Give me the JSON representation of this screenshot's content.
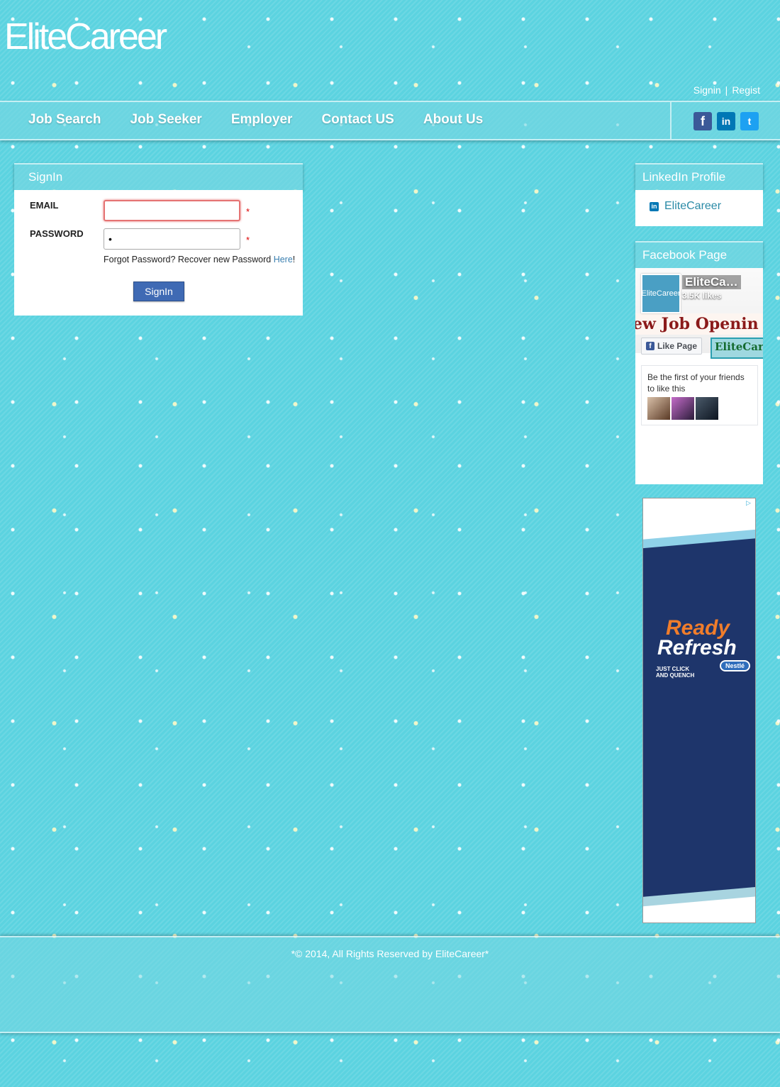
{
  "header": {
    "logo": "EliteCareer",
    "signin_link": "Signin",
    "separator": "|",
    "register_link": "Regist"
  },
  "nav": {
    "items": [
      "Job Search",
      "Job Seeker",
      "Employer",
      "Contact US",
      "About Us"
    ],
    "social": [
      {
        "icon": "facebook-icon",
        "glyph": "f"
      },
      {
        "icon": "linkedin-icon",
        "glyph": "in"
      },
      {
        "icon": "twitter-icon",
        "glyph": "t"
      }
    ]
  },
  "signin": {
    "title": "SignIn",
    "email_label": "EMAIL",
    "email_value": "",
    "password_label": "PASSWORD",
    "password_value": "•",
    "required_mark": "*",
    "forgot_text": "Forgot Password? Recover new Password ",
    "forgot_link": "Here",
    "forgot_suffix": "!",
    "button_label": "SignIn"
  },
  "linkedin_panel": {
    "title": "LinkedIn Profile",
    "link_text": "EliteCareer",
    "icon_glyph": "in"
  },
  "facebook_panel": {
    "title": "Facebook Page",
    "page_name": "EliteCa…",
    "avatar_text": "EliteCareer",
    "likes": "3.5K likes",
    "banner_text": "ew Job Openin",
    "like_button": "Like Page",
    "like_glyph": "f",
    "cover_brand": "EliteCar",
    "friends_text": "Be the first of your friends to like this"
  },
  "ad": {
    "ready": "Ready",
    "refresh": "Refresh",
    "tagline_1": "JUST CLICK",
    "tagline_2": "AND QUENCH",
    "brand": "Nestlé",
    "choice_glyph": "▷"
  },
  "footer": {
    "copyright": "*© 2014, All Rights Reserved by EliteCareer*"
  },
  "colors": {
    "background": "#5bd3e0",
    "facebook": "#3b5998",
    "linkedin": "#0077b5",
    "twitter": "#1da1f2",
    "signin_button": "#3f6ab4",
    "link": "#3a7fb0"
  }
}
